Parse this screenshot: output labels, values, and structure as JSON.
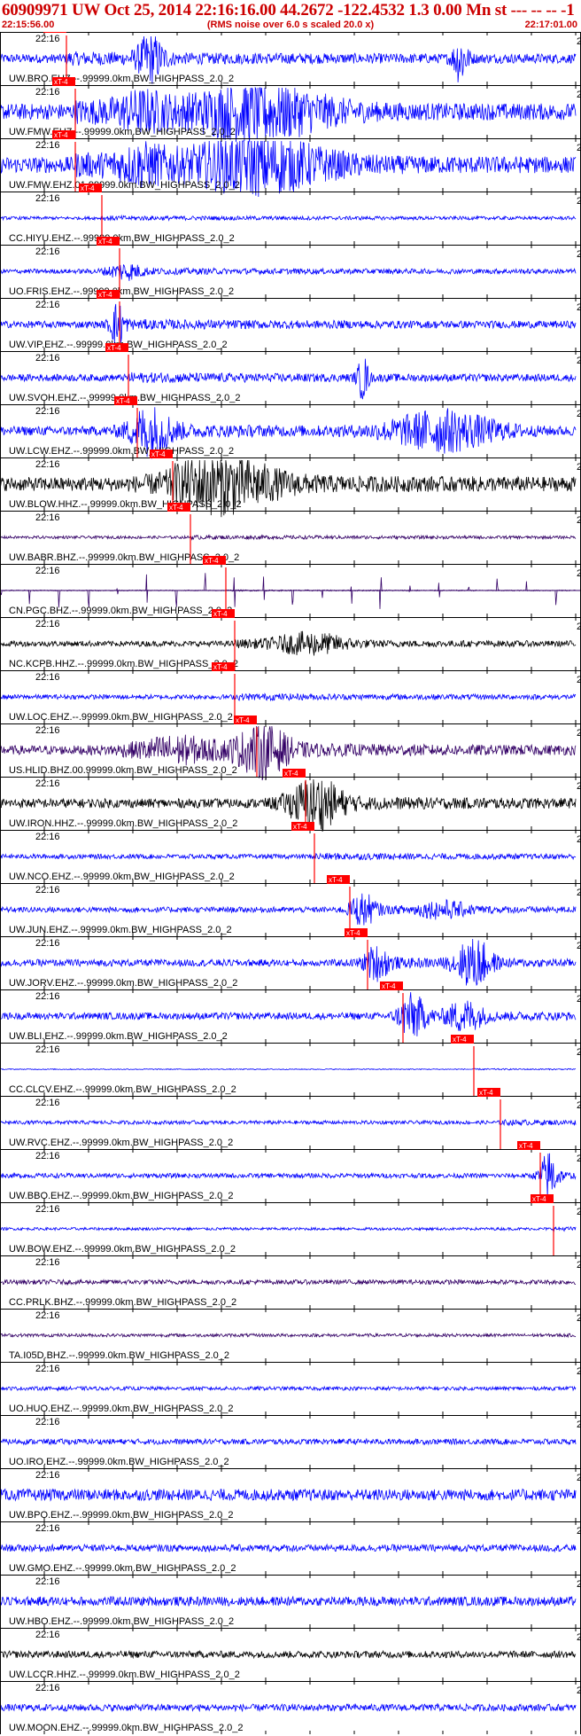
{
  "header": {
    "title": "60909971 UW Oct 25, 2014 22:16:16.00   44.2672 -122.4532  1.3 0.00 Mn st --- -- --   -1",
    "subtitle": "(RMS noise over 6.0 s scaled 20.0 x)",
    "start_time": "22:15:56.00",
    "end_time": "22:17:01.00"
  },
  "colors": {
    "header_text": "#cc0000",
    "pick": "#ff0000",
    "channel_blue": "#0000ff",
    "channel_black": "#000000",
    "channel_purple": "#330066",
    "tick": "#000000"
  },
  "chart_data": {
    "type": "line",
    "title": "60909971 UW Oct 25, 2014 22:16:16.00   44.2672 -122.4532  1.3 0.00 Mn st --- -- --   -1",
    "subtitle": "(RMS noise over 6.0 s scaled 20.0 x)",
    "xlabel": "",
    "ylabel": "",
    "x_range": [
      "22:15:56.00",
      "22:17:01.00"
    ],
    "minute_label": "22:16",
    "right_mark": "2",
    "pick_label": "xT-4",
    "grid": false,
    "series": [
      {
        "name": "UW.BRO.EHZ.--.99999.0km.BW_HIGHPASS_2.0_2",
        "color": "blue",
        "pick_s": 7.5,
        "noise": 0.2,
        "bursts": [
          {
            "t": 17,
            "a": 0.9,
            "w": 1.5
          },
          {
            "t": 52,
            "a": 1.0,
            "w": 0.8
          }
        ]
      },
      {
        "name": "UW.FMW.EHZ.--.99999.0km.BW_HIGHPASS_2.0_2",
        "color": "blue",
        "pick_s": 8.5,
        "noise": 0.35,
        "bursts": [
          {
            "t": 29,
            "a": 1.0,
            "w": 8
          },
          {
            "t": 16,
            "a": 0.5,
            "w": 3
          }
        ]
      },
      {
        "name": "UW.FMW.EHZ.01.99999.0km.BW_HIGHPASS_2.0_2",
        "color": "blue",
        "pick_s": 8.5,
        "noise": 0.35,
        "bursts": [
          {
            "t": 29,
            "a": 1.0,
            "w": 8
          },
          {
            "t": 16,
            "a": 0.5,
            "w": 3
          }
        ]
      },
      {
        "name": "CC.HIYU.EHZ.--.99999.0km.BW_HIGHPASS_2.0_2",
        "color": "blue",
        "pick_s": 11.5,
        "noise": 0.07,
        "bursts": []
      },
      {
        "name": "UO.FRIS.EHZ.--.99999.0km.BW_HIGHPASS_2.0_2",
        "color": "blue",
        "pick_s": 13.5,
        "noise": 0.1,
        "bursts": [
          {
            "t": 14,
            "a": 0.3,
            "w": 2
          }
        ]
      },
      {
        "name": "UW.VIP.EHZ.--.99999.0km.BW_HIGHPASS_2.0_2",
        "color": "blue",
        "pick_s": 13.5,
        "noise": 0.15,
        "bursts": [
          {
            "t": 13.2,
            "a": 0.9,
            "w": 0.8
          }
        ]
      },
      {
        "name": "UW.SVOH.EHZ.--.99999.0km.BW_HIGHPASS_2.0_2",
        "color": "blue",
        "pick_s": 14.5,
        "noise": 0.15,
        "bursts": [
          {
            "t": 41,
            "a": 0.9,
            "w": 0.6
          }
        ]
      },
      {
        "name": "UW.LCW.EHZ.--.99999.0km.BW_HIGHPASS_2.0_2",
        "color": "blue",
        "pick_s": 15.5,
        "noise": 0.2,
        "bursts": [
          {
            "t": 17,
            "a": 0.9,
            "w": 2.5
          },
          {
            "t": 50,
            "a": 0.8,
            "w": 6
          }
        ]
      },
      {
        "name": "UW.BLOW.HHZ.--.99999.0km.BW_HIGHPASS_2.0_2",
        "color": "black",
        "pick_s": 19.5,
        "noise": 0.3,
        "bursts": [
          {
            "t": 25,
            "a": 1.0,
            "w": 6
          }
        ]
      },
      {
        "name": "UW.BABR.BHZ.--.99999.0km.BW_HIGHPASS_2.0_2",
        "color": "purple",
        "pick_s": 21.5,
        "noise": 0.06,
        "bursts": []
      },
      {
        "name": "CN.PGC.BHZ.--.99999.0km.BW_HIGHPASS_2.0_2",
        "color": "purple",
        "pick_s": 25.5,
        "noise": 0.02,
        "bursts": [],
        "spikes": true
      },
      {
        "name": "NC.KCPB.HHZ.--.99999.0km.BW_HIGHPASS_2.0_2",
        "color": "black",
        "pick_s": 26.5,
        "noise": 0.12,
        "bursts": [
          {
            "t": 35,
            "a": 0.4,
            "w": 4
          }
        ]
      },
      {
        "name": "UW.LOC.EHZ.--.99999.0km.BW_HIGHPASS_2.0_2",
        "color": "blue",
        "pick_s": 26.5,
        "noise": 0.1,
        "bursts": []
      },
      {
        "name": "US.HLID.BHZ.00.99999.0km.BW_HIGHPASS_2.0_2",
        "color": "purple",
        "pick_s": 29,
        "noise": 0.2,
        "bursts": [
          {
            "t": 29.5,
            "a": 1.0,
            "w": 3
          },
          {
            "t": 20,
            "a": 0.5,
            "w": 5
          }
        ]
      },
      {
        "name": "UW.IRON.HHZ.--.99999.0km.BW_HIGHPASS_2.0_2",
        "color": "black",
        "pick_s": 34.5,
        "noise": 0.2,
        "bursts": [
          {
            "t": 35.5,
            "a": 1.0,
            "w": 3
          }
        ]
      },
      {
        "name": "UW.NCO.EHZ.--.99999.0km.BW_HIGHPASS_2.0_2",
        "color": "blue",
        "pick_s": 35.5,
        "noise": 0.1,
        "bursts": []
      },
      {
        "name": "UW.JUN.EHZ.--.99999.0km.BW_HIGHPASS_2.0_2",
        "color": "blue",
        "pick_s": 39.5,
        "noise": 0.12,
        "bursts": [
          {
            "t": 41,
            "a": 0.6,
            "w": 1.5
          },
          {
            "t": 50,
            "a": 0.3,
            "w": 3
          }
        ]
      },
      {
        "name": "UW.JORV.EHZ.--.99999.0km.BW_HIGHPASS_2.0_2",
        "color": "blue",
        "pick_s": 41.5,
        "noise": 0.15,
        "bursts": [
          {
            "t": 42.5,
            "a": 0.6,
            "w": 1.5
          },
          {
            "t": 53.5,
            "a": 1.0,
            "w": 2
          }
        ]
      },
      {
        "name": "UW.BLI.EHZ.--.99999.0km.BW_HIGHPASS_2.0_2",
        "color": "blue",
        "pick_s": 45.5,
        "noise": 0.15,
        "bursts": [
          {
            "t": 46.5,
            "a": 0.9,
            "w": 1.5
          },
          {
            "t": 52.5,
            "a": 0.6,
            "w": 2
          }
        ]
      },
      {
        "name": "CC.CLCV.EHZ.--.99999.0km.BW_HIGHPASS_2.0_2",
        "color": "blue",
        "pick_s": 53.5,
        "noise": 0.02,
        "bursts": []
      },
      {
        "name": "UW.RVC.EHZ.--.99999.0km.BW_HIGHPASS_2.0_2",
        "color": "blue",
        "pick_s": 56.5,
        "noise": 0.08,
        "bursts": []
      },
      {
        "name": "UW.BBO.EHZ.--.99999.0km.BW_HIGHPASS_2.0_2",
        "color": "blue",
        "pick_s": 61.0,
        "noise": 0.1,
        "bursts": [
          {
            "t": 62,
            "a": 1.0,
            "w": 1
          }
        ]
      },
      {
        "name": "UW.BOW.EHZ.--.99999.0km.BW_HIGHPASS_2.0_2",
        "color": "blue",
        "pick_s": 62.5,
        "noise": 0.06,
        "bursts": []
      },
      {
        "name": "CC.PRLK.BHZ.--.99999.0km.BW_HIGHPASS_2.0_2",
        "color": "purple",
        "pick_s": null,
        "noise": 0.1,
        "bursts": []
      },
      {
        "name": "TA.I05D.BHZ.--.99999.0km.BW_HIGHPASS_2.0_2",
        "color": "purple",
        "pick_s": null,
        "noise": 0.07,
        "bursts": []
      },
      {
        "name": "UO.HUO.EHZ.--.99999.0km.BW_HIGHPASS_2.0_2",
        "color": "blue",
        "pick_s": null,
        "noise": 0.08,
        "bursts": []
      },
      {
        "name": "UO.IRO.EHZ.--.99999.0km.BW_HIGHPASS_2.0_2",
        "color": "blue",
        "pick_s": null,
        "noise": 0.12,
        "bursts": []
      },
      {
        "name": "UW.BPO.EHZ.--.99999.0km.BW_HIGHPASS_2.0_2",
        "color": "blue",
        "pick_s": null,
        "noise": 0.25,
        "bursts": []
      },
      {
        "name": "UW.GMO.EHZ.--.99999.0km.BW_HIGHPASS_2.0_2",
        "color": "blue",
        "pick_s": null,
        "noise": 0.15,
        "bursts": []
      },
      {
        "name": "UW.HBO.EHZ.--.99999.0km.BW_HIGHPASS_2.0_2",
        "color": "blue",
        "pick_s": null,
        "noise": 0.2,
        "bursts": []
      },
      {
        "name": "UW.LCCR.HHZ.--.99999.0km.BW_HIGHPASS_2.0_2",
        "color": "black",
        "pick_s": null,
        "noise": 0.15,
        "bursts": []
      },
      {
        "name": "UW.MOON.EHZ.--.99999.0km.BW_HIGHPASS_2.0_2",
        "color": "blue",
        "pick_s": null,
        "noise": 0.15,
        "bursts": []
      }
    ]
  }
}
